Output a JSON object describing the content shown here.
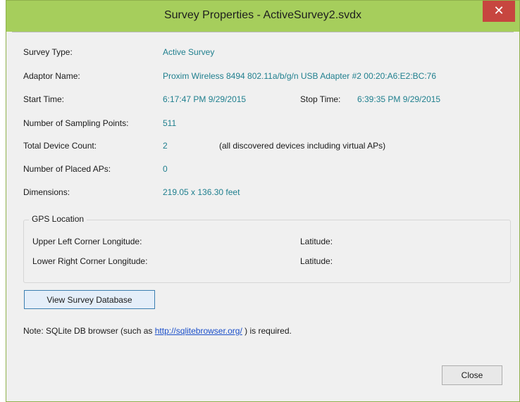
{
  "window": {
    "title": "Survey Properties - ActiveSurvey2.svdx",
    "close_glyph": "✕"
  },
  "fields": {
    "survey_type": {
      "label": "Survey Type:",
      "value": "Active Survey"
    },
    "adaptor_name": {
      "label": "Adaptor Name:",
      "value": "Proxim Wireless 8494 802.11a/b/g/n USB Adapter #2 00:20:A6:E2:BC:76"
    },
    "start_time": {
      "label": "Start Time:",
      "value": "6:17:47 PM 9/29/2015"
    },
    "stop_time": {
      "label": "Stop Time:",
      "value": "6:39:35 PM 9/29/2015"
    },
    "sampling_points": {
      "label": "Number of Sampling Points:",
      "value": "511"
    },
    "device_count": {
      "label": "Total Device Count:",
      "value": "2",
      "note": "(all discovered devices including virtual APs)"
    },
    "placed_aps": {
      "label": "Number of Placed APs:",
      "value": "0"
    },
    "dimensions": {
      "label": "Dimensions:",
      "value": "219.05 x 136.30 feet"
    }
  },
  "gps": {
    "legend": "GPS Location",
    "upper_left_label": "Upper Left Corner Longitude:",
    "upper_left_lat_label": "Latitude:",
    "lower_right_label": "Lower Right Corner Longitude:",
    "lower_right_lat_label": "Latitude:"
  },
  "buttons": {
    "view_db": "View Survey Database",
    "close": "Close"
  },
  "note": {
    "prefix": "Note: SQLite DB browser (such as ",
    "link": "http://sqlitebrowser.org/",
    "suffix": " ) is required."
  },
  "colors": {
    "title_bar": "#a6ce5c",
    "value_text": "#1f7f8e",
    "close_button": "#c7463f",
    "link": "#1a4ec9"
  }
}
